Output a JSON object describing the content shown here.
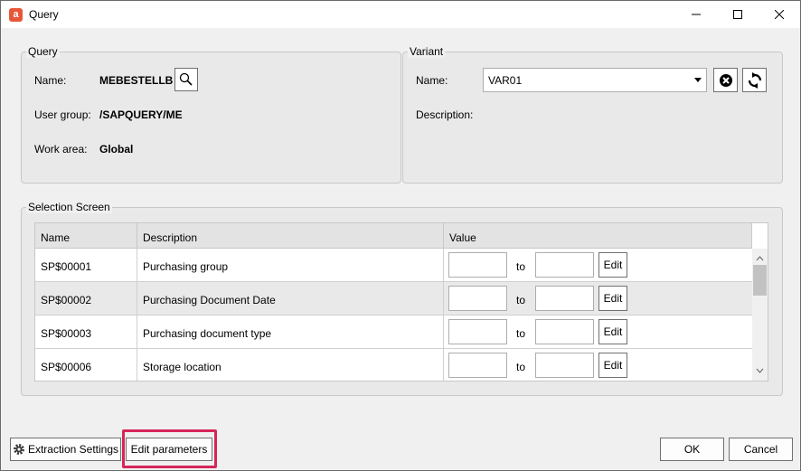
{
  "window": {
    "title": "Query",
    "app_icon_letter": "a"
  },
  "query": {
    "group_title": "Query",
    "name_label": "Name:",
    "name_value": "MEBESTELLB",
    "user_group_label": "User group:",
    "user_group_value": "/SAPQUERY/ME",
    "work_area_label": "Work area:",
    "work_area_value": "Global"
  },
  "variant": {
    "group_title": "Variant",
    "name_label": "Name:",
    "name_value": "VAR01",
    "description_label": "Description:"
  },
  "selection": {
    "group_title": "Selection Screen",
    "columns": [
      "Name",
      "Description",
      "Value"
    ],
    "to_label": "to",
    "edit_label": "Edit",
    "rows": [
      {
        "name": "SP$00001",
        "description": "Purchasing group"
      },
      {
        "name": "SP$00002",
        "description": "Purchasing Document Date"
      },
      {
        "name": "SP$00003",
        "description": "Purchasing document type"
      },
      {
        "name": "SP$00006",
        "description": "Storage location"
      }
    ]
  },
  "footer": {
    "extraction_settings": "Extraction Settings",
    "edit_parameters": "Edit parameters",
    "ok": "OK",
    "cancel": "Cancel"
  },
  "colors": {
    "highlight": "#d6265a",
    "app_icon": "#e8563a"
  }
}
